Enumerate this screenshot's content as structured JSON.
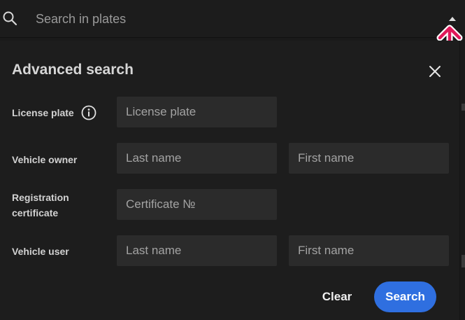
{
  "search": {
    "placeholder": "Search in plates"
  },
  "icons": {
    "search": "search-icon",
    "expand": "caret-up-icon",
    "annotation": "red-up-arrow-annotation",
    "close": "close-icon",
    "info": "info-icon"
  },
  "colors": {
    "primary_button": "#2f6fe0",
    "annotation_arrow": "#e0195a",
    "background": "#1d1d1d",
    "field_background": "#2b2b2b"
  },
  "panel": {
    "title": "Advanced search",
    "rows": {
      "license_plate": {
        "label": "License plate",
        "placeholder": "License plate"
      },
      "vehicle_owner": {
        "label": "Vehicle owner",
        "last_name_placeholder": "Last name",
        "first_name_placeholder": "First name"
      },
      "registration_certificate": {
        "label_line1": "Registration",
        "label_line2": "certificate",
        "placeholder": "Certificate №"
      },
      "vehicle_user": {
        "label": "Vehicle user",
        "last_name_placeholder": "Last name",
        "first_name_placeholder": "First name"
      }
    },
    "buttons": {
      "clear": "Clear",
      "search": "Search"
    }
  }
}
